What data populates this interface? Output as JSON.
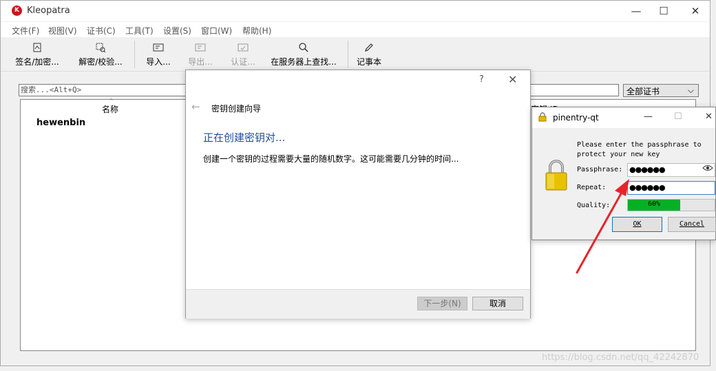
{
  "app": {
    "title": "Kleopatra",
    "icon_letter": "K"
  },
  "window_controls": {
    "minimize": "—",
    "maximize": "☐",
    "close": "✕"
  },
  "menu": [
    "文件(F)",
    "视图(V)",
    "证书(C)",
    "工具(T)",
    "设置(S)",
    "窗口(W)",
    "帮助(H)"
  ],
  "toolbar": {
    "sign": "签名/加密...",
    "decrypt": "解密/校验...",
    "import": "导入...",
    "export": "导出...",
    "certify": "认证...",
    "lookup": "在服务器上查找...",
    "notepad": "记事本"
  },
  "search": {
    "placeholder": "搜索...<Alt+Q>"
  },
  "filter": {
    "selected": "全部证书"
  },
  "cert_list": {
    "columns": {
      "name": "名称",
      "key_id": "密钥 ID"
    },
    "rows": [
      {
        "name": "hewenbin"
      }
    ]
  },
  "wizard": {
    "help": "?",
    "close": "✕",
    "back": "←",
    "title": "密钥创建向导",
    "heading": "正在创建密钥对...",
    "description": "创建一个密钥的过程需要大量的随机数字。这可能需要几分钟的时间...",
    "next_label": "下一步(N)",
    "cancel_label": "取消"
  },
  "pinentry": {
    "title": "pinentry-qt",
    "message_line1": "Please enter the passphrase to",
    "message_line2": "protect your new key",
    "passphrase_label": "Passphrase:",
    "passphrase_value": "●●●●●●",
    "repeat_label": "Repeat:",
    "repeat_value": "●●●●●●",
    "quality_label": "Quality:",
    "quality_text": "60%",
    "quality_percent": 60,
    "ok_label": "OK",
    "cancel_label": "Cancel"
  },
  "watermark": "https://blog.csdn.net/qq_42242870",
  "colors": {
    "accent": "#0078d7",
    "heading": "#1f4e9c",
    "quality": "#06b025",
    "annotation_arrow": "#e8242a"
  }
}
